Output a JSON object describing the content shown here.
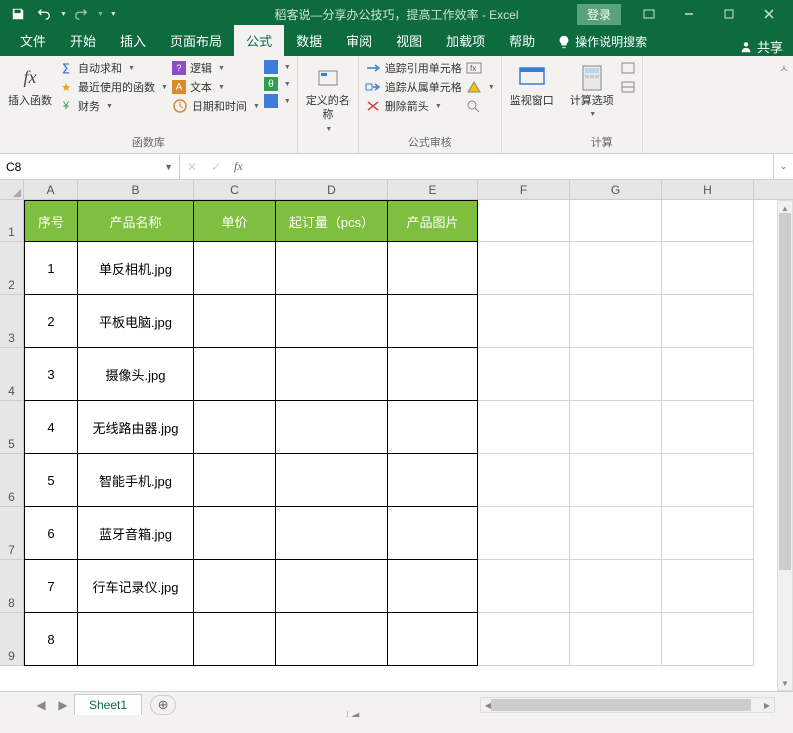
{
  "title": "稻客说—分享办公技巧，提高工作效率 - Excel",
  "login": "登录",
  "tabs": [
    "文件",
    "开始",
    "插入",
    "页面布局",
    "公式",
    "数据",
    "审阅",
    "视图",
    "加载项",
    "帮助"
  ],
  "tellme": "操作说明搜索",
  "share": "共享",
  "ribbon": {
    "insert_fn": "插入函数",
    "autosum": "自动求和",
    "recently": "最近使用的函数",
    "financial": "财务",
    "logical": "逻辑",
    "text": "文本",
    "datetime": "日期和时间",
    "define_name": "定义的名称",
    "trace_prec": "追踪引用单元格",
    "trace_dep": "追踪从属单元格",
    "remove_arrows": "删除箭头",
    "watch": "监视窗口",
    "calc_opts": "计算选项",
    "g_lib": "函数库",
    "g_audit": "公式审核",
    "g_calc": "计算"
  },
  "namebox": "C8",
  "columns": [
    "A",
    "B",
    "C",
    "D",
    "E",
    "F",
    "G",
    "H"
  ],
  "rows": [
    "1",
    "2",
    "3",
    "4",
    "5",
    "6",
    "7",
    "8",
    "9"
  ],
  "header_row": [
    "序号",
    "产品名称",
    "单价",
    "起订量（pcs）",
    "产品图片"
  ],
  "data_rows": [
    [
      "1",
      "单反相机.jpg",
      "",
      "",
      ""
    ],
    [
      "2",
      "平板电脑.jpg",
      "",
      "",
      ""
    ],
    [
      "3",
      "摄像头.jpg",
      "",
      "",
      ""
    ],
    [
      "4",
      "无线路由器.jpg",
      "",
      "",
      ""
    ],
    [
      "5",
      "智能手机.jpg",
      "",
      "",
      ""
    ],
    [
      "6",
      "蓝牙音箱.jpg",
      "",
      "",
      ""
    ],
    [
      "7",
      "行车记录仪.jpg",
      "",
      "",
      ""
    ],
    [
      "8",
      "",
      "",
      "",
      ""
    ]
  ],
  "sheet": "Sheet1"
}
